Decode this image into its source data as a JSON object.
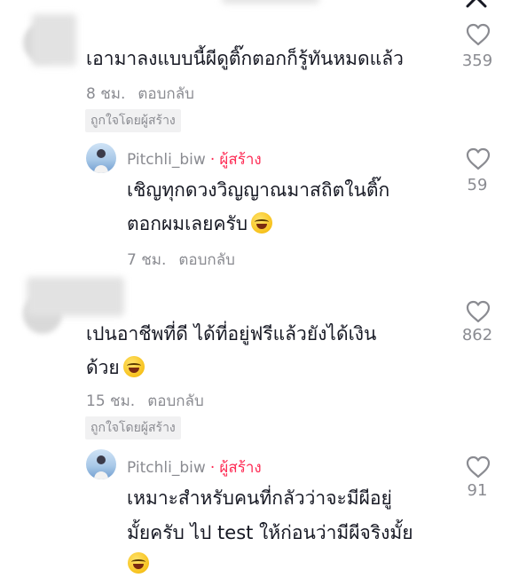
{
  "colors": {
    "creator": "#fe2c55",
    "meta": "#8a8b91",
    "text": "#161823",
    "badge_bg": "#f1f1f2"
  },
  "header": {
    "close_icon": "chevron-up-icon"
  },
  "comments": [
    {
      "text_lines": [
        "เอามาลงแบบนี้ผีดูติ๊กตอกก็รู้ทันหมดแล้ว"
      ],
      "time": "8 ชม.",
      "reply_label": "ตอบกลับ",
      "liked_by_creator": "ถูกใจโดยผู้สร้าง",
      "likes": "359",
      "reply": {
        "author": "Pitchli_biw",
        "sep": "·",
        "creator_label": "ผู้สร้าง",
        "text_lines": [
          "เชิญทุกดวงวิญญาณมาสถิตในติ๊ก",
          "ตอกผมเลยครับ"
        ],
        "time": "7 ชม.",
        "reply_label": "ตอบกลับ",
        "likes": "59"
      }
    },
    {
      "text_lines": [
        "เปนอาชีพที่ดี ได้ที่อยู่ฟรีแล้วยังได้เงิน",
        "ด้วย"
      ],
      "time": "15 ชม.",
      "reply_label": "ตอบกลับ",
      "liked_by_creator": "ถูกใจโดยผู้สร้าง",
      "likes": "862",
      "reply": {
        "author": "Pitchli_biw",
        "sep": "·",
        "creator_label": "ผู้สร้าง",
        "text_lines": [
          "เหมาะสำหรับคนที่กลัวว่าจะมีผีอยู่",
          "มั้ยครับ ไป test ให้ก่อนว่ามีผีจริงมั้ย"
        ],
        "likes": "91"
      }
    }
  ]
}
